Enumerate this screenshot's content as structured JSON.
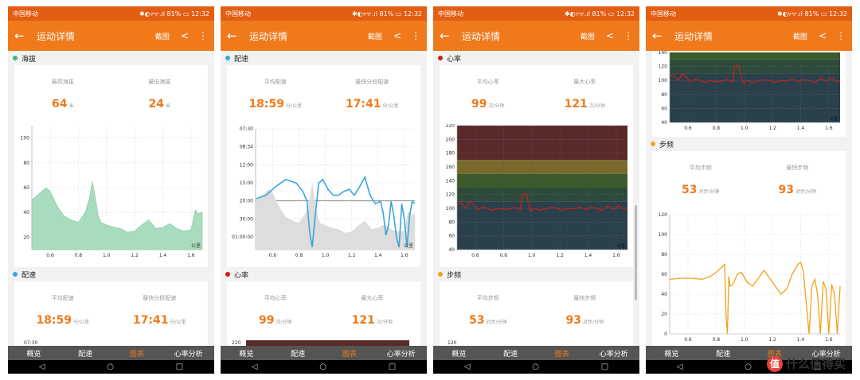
{
  "status": {
    "carrier": "中国移动",
    "icons": "✱◐▿ᯤ.ıl 81% ▭",
    "time": "12:32"
  },
  "appbar": {
    "title": "运动详情",
    "screenshot_label": "截图"
  },
  "tabs": [
    "概览",
    "配速",
    "图表",
    "心率分析"
  ],
  "active_tab_index": 2,
  "colors": {
    "brand": "#f07a1b",
    "status_bar": "#e35d12",
    "altitude": "#a9dcbf",
    "pace": "#3aa6d8",
    "heart_rate": "#cc1e1e",
    "cadence": "#f0a21b"
  },
  "sections": {
    "altitude": {
      "title": "海拔",
      "avg_label": "最高海拔",
      "avg_value": "64",
      "avg_unit": "米",
      "max_label": "最低海拔",
      "max_value": "24",
      "max_unit": "米"
    },
    "pace": {
      "title": "配速",
      "avg_label": "平均配速",
      "avg_value": "18:59",
      "avg_unit": "分/公里",
      "max_label": "最快分段配速",
      "max_value": "17:41",
      "max_unit": "分/公里"
    },
    "heart_rate": {
      "title": "心率",
      "avg_label": "平均心率",
      "avg_value": "99",
      "avg_unit": "次/分钟",
      "max_label": "最大心率",
      "max_value": "121",
      "max_unit": "次/分钟"
    },
    "cadence": {
      "title": "步频",
      "avg_label": "平均步频",
      "avg_value": "53",
      "avg_unit": "对步/分钟",
      "max_label": "最快步频",
      "max_value": "93",
      "max_unit": "对步/分钟"
    }
  },
  "axis_unit": "公里",
  "chart_data": [
    {
      "type": "area",
      "name": "altitude",
      "y_ticks": [
        "100",
        "80",
        "60",
        "40",
        "20"
      ],
      "x_ticks": [
        "0.6",
        "0.8",
        "1.0",
        "1.2",
        "1.4",
        "1.6"
      ],
      "xlim": [
        0.47,
        1.68
      ],
      "ylim": [
        10,
        110
      ],
      "x": [
        0.47,
        0.52,
        0.57,
        0.6,
        0.65,
        0.7,
        0.75,
        0.8,
        0.85,
        0.88,
        0.9,
        0.92,
        0.94,
        0.96,
        1.0,
        1.05,
        1.1,
        1.15,
        1.2,
        1.25,
        1.3,
        1.35,
        1.4,
        1.45,
        1.5,
        1.55,
        1.6,
        1.63,
        1.65,
        1.68
      ],
      "y": [
        50,
        55,
        60,
        57,
        45,
        37,
        34,
        32,
        40,
        52,
        65,
        52,
        38,
        32,
        30,
        28,
        27,
        24,
        25,
        30,
        34,
        27,
        28,
        31,
        27,
        25,
        26,
        42,
        39,
        40
      ]
    },
    {
      "type": "line",
      "name": "pace",
      "y_ticks": [
        "07:30",
        "08:34",
        "12:00",
        "15:00",
        "20:00",
        "30:00",
        "01:00:00"
      ],
      "x_ticks": [
        "0.6",
        "0.8",
        "1.0",
        "1.2",
        "1.4",
        "1.6"
      ],
      "xlim": [
        0.47,
        1.68
      ],
      "x": [
        0.47,
        0.55,
        0.62,
        0.7,
        0.78,
        0.83,
        0.86,
        0.88,
        0.9,
        0.92,
        0.95,
        0.98,
        1.02,
        1.06,
        1.1,
        1.14,
        1.18,
        1.22,
        1.26,
        1.3,
        1.34,
        1.38,
        1.42,
        1.44,
        1.46,
        1.48,
        1.5,
        1.52,
        1.54,
        1.56,
        1.58,
        1.6,
        1.62,
        1.64,
        1.66,
        1.68
      ],
      "y_pos": [
        0.58,
        0.55,
        0.48,
        0.42,
        0.45,
        0.52,
        0.6,
        0.85,
        0.98,
        0.75,
        0.45,
        0.42,
        0.5,
        0.55,
        0.55,
        0.52,
        0.5,
        0.55,
        0.48,
        0.4,
        0.55,
        0.62,
        0.6,
        0.7,
        0.88,
        0.8,
        0.6,
        0.72,
        0.9,
        0.98,
        0.62,
        0.75,
        0.98,
        0.72,
        0.6,
        0.62
      ],
      "ref_line_label": "20:00"
    },
    {
      "type": "line",
      "name": "heart_rate",
      "y_ticks": [
        "220",
        "200",
        "180",
        "160",
        "140",
        "120",
        "100",
        "80",
        "60",
        "40"
      ],
      "x_ticks": [
        "0.6",
        "0.8",
        "1.0",
        "1.2",
        "1.4",
        "1.6"
      ],
      "xlim": [
        0.47,
        1.68
      ],
      "ylim": [
        40,
        220
      ],
      "zones": [
        {
          "from": 170,
          "to": 220,
          "color": "#5a2a2a"
        },
        {
          "from": 150,
          "to": 170,
          "color": "#7a6a2a"
        },
        {
          "from": 130,
          "to": 150,
          "color": "#3d5a2a"
        },
        {
          "from": 110,
          "to": 130,
          "color": "#2d4a3a"
        },
        {
          "from": 40,
          "to": 110,
          "color": "#2a404a"
        }
      ],
      "x": [
        0.47,
        0.5,
        0.53,
        0.56,
        0.59,
        0.62,
        0.65,
        0.68,
        0.72,
        0.76,
        0.8,
        0.84,
        0.88,
        0.92,
        0.93,
        0.96,
        0.99,
        1.02,
        1.06,
        1.1,
        1.14,
        1.18,
        1.22,
        1.26,
        1.3,
        1.34,
        1.38,
        1.42,
        1.46,
        1.5,
        1.54,
        1.58,
        1.62,
        1.66,
        1.68
      ],
      "y": [
        105,
        108,
        100,
        110,
        104,
        98,
        102,
        100,
        97,
        100,
        98,
        99,
        101,
        98,
        120,
        121,
        96,
        100,
        97,
        99,
        101,
        100,
        97,
        100,
        99,
        102,
        98,
        101,
        100,
        97,
        103,
        99,
        104,
        98,
        100
      ]
    },
    {
      "type": "line",
      "name": "cadence",
      "y_ticks": [
        "120",
        "100",
        "80",
        "60",
        "40",
        "20",
        "0"
      ],
      "x_ticks": [
        "0.6",
        "0.8",
        "1.0",
        "1.2",
        "1.4",
        "1.6"
      ],
      "xlim": [
        0.47,
        1.68
      ],
      "ylim": [
        0,
        120
      ],
      "x": [
        0.47,
        0.55,
        0.62,
        0.7,
        0.76,
        0.8,
        0.84,
        0.86,
        0.87,
        0.88,
        0.89,
        0.9,
        0.92,
        0.95,
        0.98,
        1.02,
        1.06,
        1.1,
        1.14,
        1.18,
        1.22,
        1.26,
        1.3,
        1.34,
        1.38,
        1.4,
        1.42,
        1.44,
        1.46,
        1.48,
        1.5,
        1.52,
        1.54,
        1.56,
        1.58,
        1.6,
        1.62,
        1.64,
        1.66,
        1.68
      ],
      "y": [
        55,
        56,
        56,
        55,
        58,
        62,
        67,
        70,
        20,
        0,
        58,
        48,
        50,
        60,
        62,
        52,
        48,
        56,
        64,
        56,
        48,
        40,
        45,
        60,
        70,
        72,
        62,
        30,
        0,
        48,
        55,
        40,
        0,
        53,
        45,
        0,
        50,
        40,
        0,
        48
      ]
    }
  ]
}
